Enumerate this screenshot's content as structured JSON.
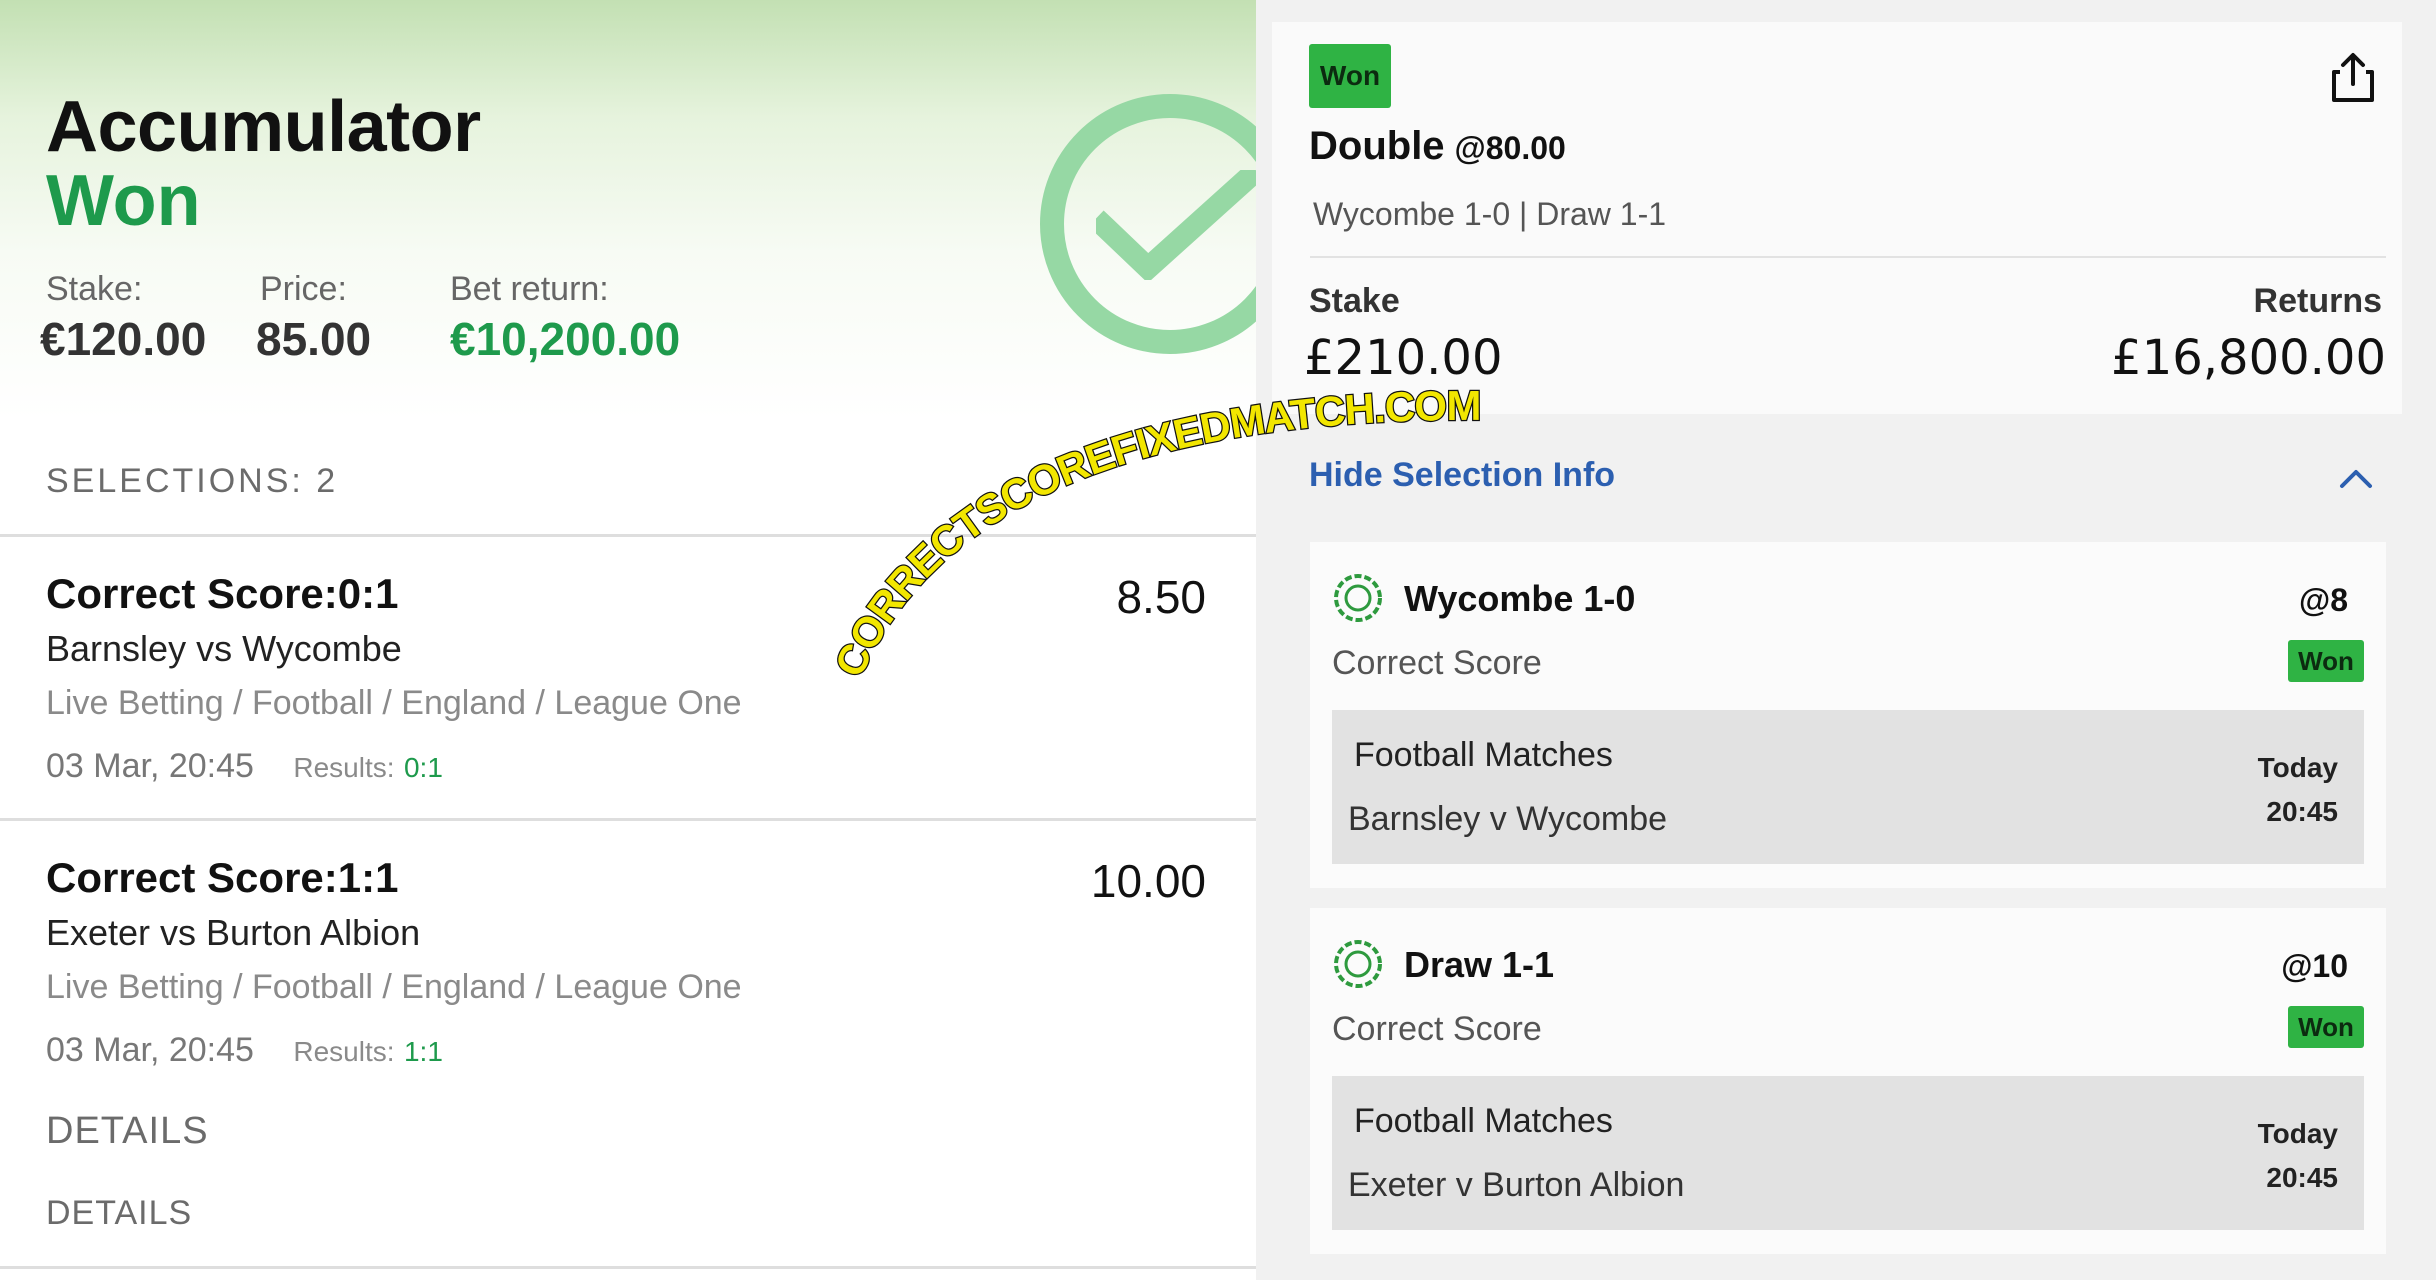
{
  "accumulator": {
    "title": "Accumulator",
    "status": "Won",
    "stake_label": "Stake:",
    "stake_value": "€120.00",
    "price_label": "Price:",
    "price_value": "85.00",
    "return_label": "Bet return:",
    "return_value": "€10,200.00",
    "selections_label": "SELECTIONS: 2",
    "selections": [
      {
        "market": "Correct Score:",
        "score": "0:1",
        "odds": "8.50",
        "teams": "Barnsley vs Wycombe",
        "path": "Live Betting / Football / England / League One",
        "datetime": "03 Mar, 20:45",
        "results_label": "Results:",
        "results_value": "0:1"
      },
      {
        "market": "Correct Score:",
        "score": "1:1",
        "odds": "10.00",
        "teams": "Exeter vs Burton Albion",
        "path": "Live Betting / Football / England / League One",
        "datetime": "03 Mar, 20:45",
        "results_label": "Results:",
        "results_value": "1:1"
      }
    ],
    "details_1": "DETAILS",
    "details_2": "DETAILS",
    "accent_color": "#1e9a4c"
  },
  "bet_slip": {
    "status_badge": "Won",
    "bet_type": "Double",
    "bet_odds": "@80.00",
    "summary": "Wycombe 1-0 | Draw 1-1",
    "stake_label": "Stake",
    "stake_value": "£210.00",
    "returns_label": "Returns",
    "returns_value": "£16,800.00",
    "hide_info_label": "Hide Selection Info",
    "legs": [
      {
        "title": "Wycombe 1-0",
        "odds": "@8",
        "market": "Correct Score",
        "status": "Won",
        "competition": "Football Matches",
        "event": "Barnsley v Wycombe",
        "day": "Today",
        "time": "20:45"
      },
      {
        "title": "Draw 1-1",
        "odds": "@10",
        "market": "Correct Score",
        "status": "Won",
        "competition": "Football Matches",
        "event": "Exeter v Burton Albion",
        "day": "Today",
        "time": "20:45"
      }
    ],
    "won_color": "#2fb344",
    "link_color": "#2c5fb0",
    "icons": [
      "share-icon",
      "chevron-up-icon",
      "selection-target-icon"
    ]
  },
  "watermark": {
    "text": "CORRECTSCOREFIXEDMATCH.COM"
  }
}
